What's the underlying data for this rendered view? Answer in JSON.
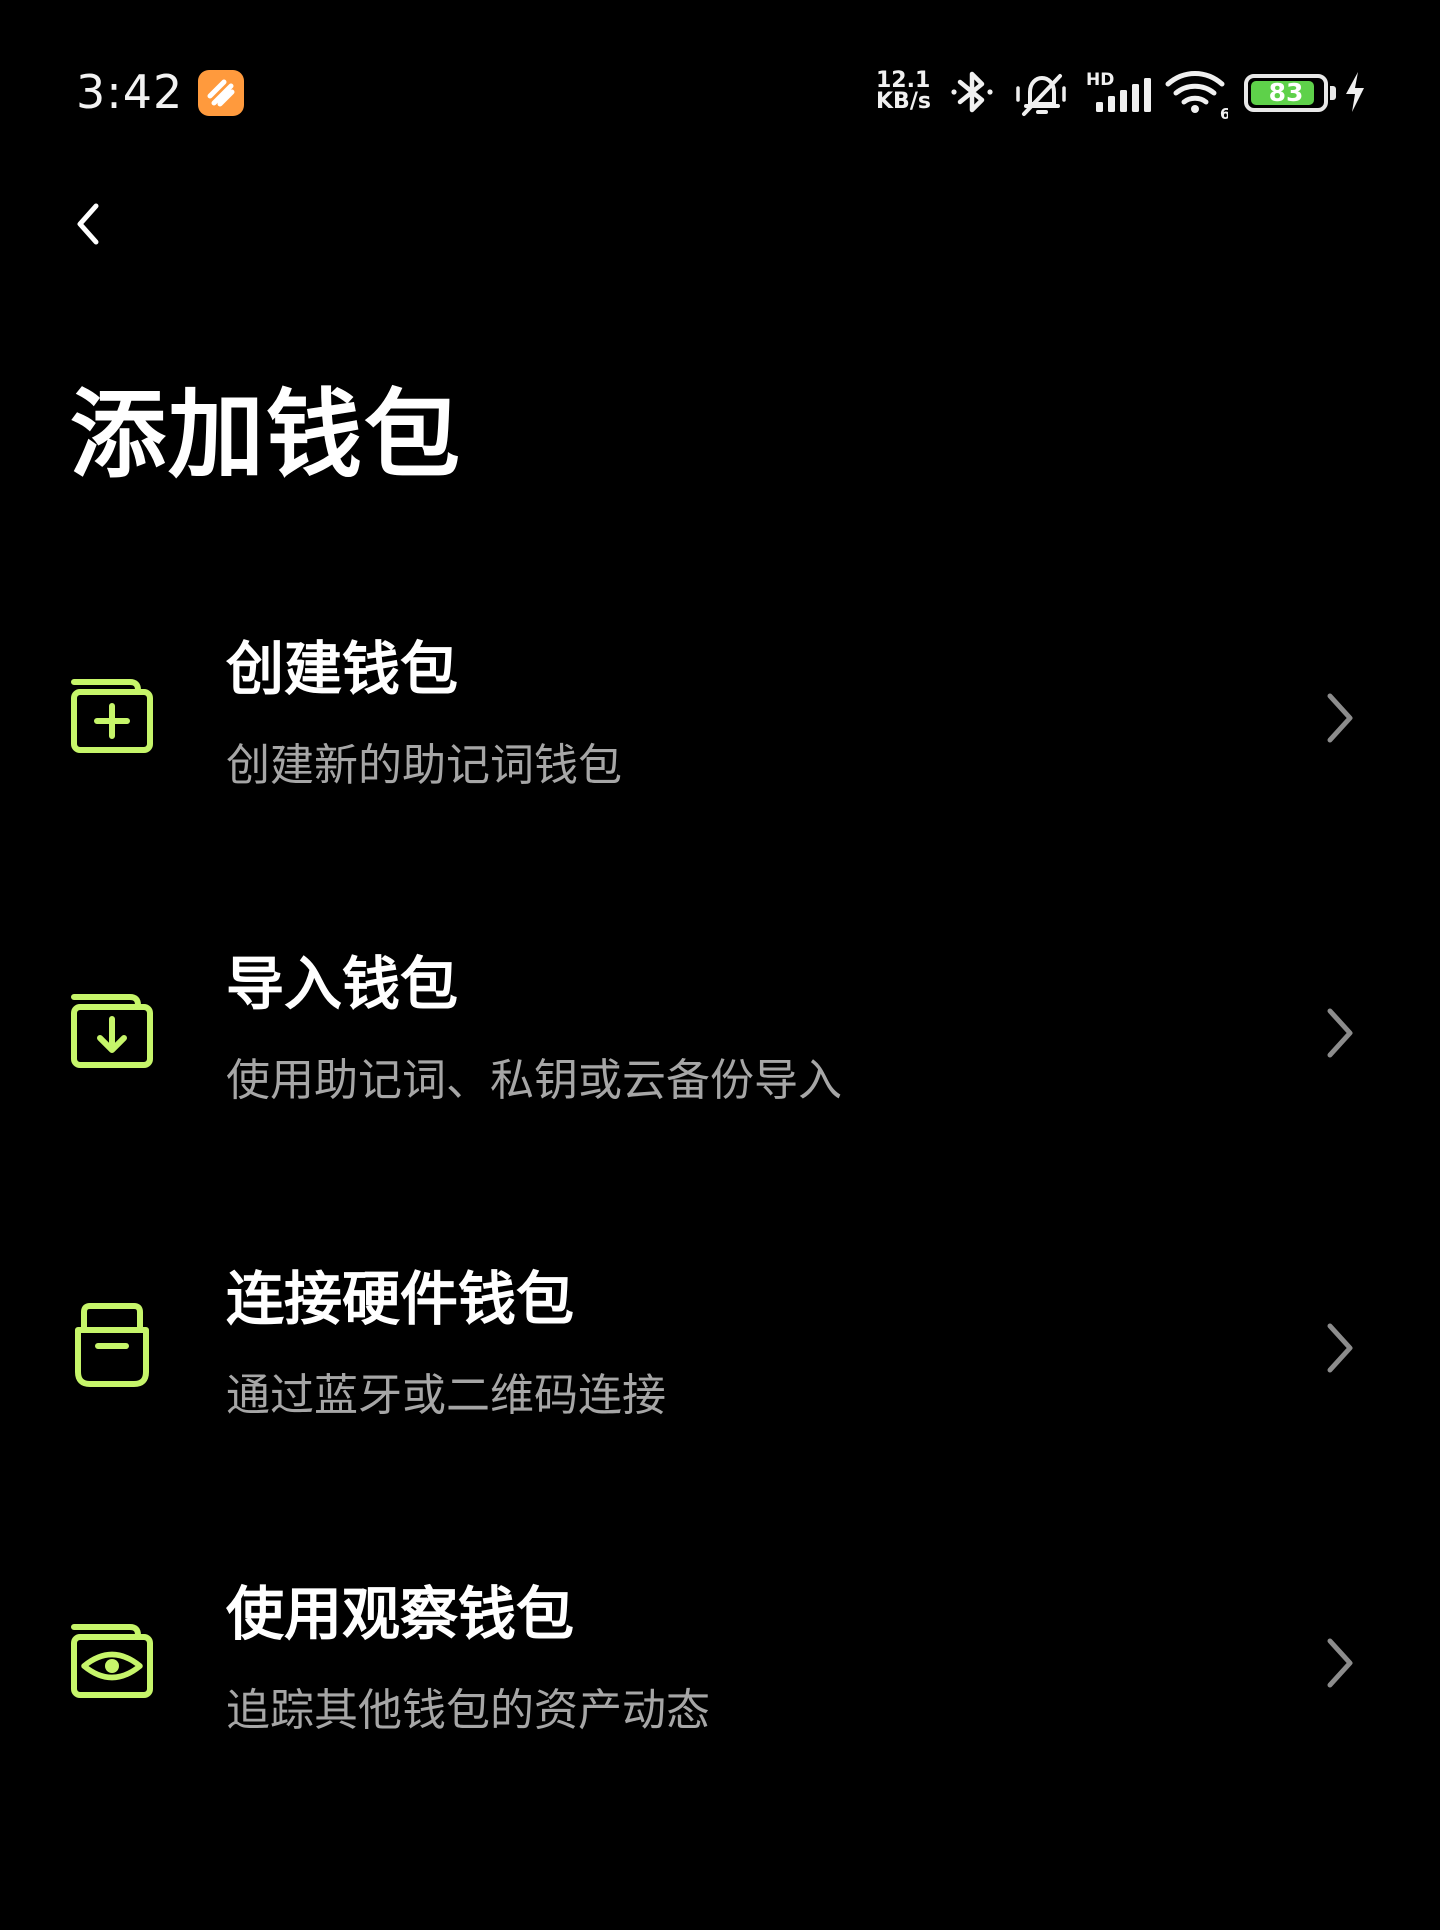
{
  "status_bar": {
    "time": "3:42",
    "net_speed_value": "12.1",
    "net_speed_unit": "KB/s",
    "network_badge": "HD",
    "wifi_badge": "6",
    "battery_level": "83",
    "battery_fraction": 0.83,
    "icons": [
      "app-notification-icon",
      "bluetooth-icon",
      "mute-icon",
      "cellular-signal-icon",
      "wifi-icon",
      "battery-icon",
      "charging-icon"
    ]
  },
  "header": {
    "back_icon": "chevron-left-icon",
    "title": "添加钱包"
  },
  "options": [
    {
      "icon": "wallet-plus-icon",
      "title": "创建钱包",
      "description": "创建新的助记词钱包"
    },
    {
      "icon": "wallet-import-icon",
      "title": "导入钱包",
      "description": "使用助记词、私钥或云备份导入"
    },
    {
      "icon": "hardware-wallet-icon",
      "title": "连接硬件钱包",
      "description": "通过蓝牙或二维码连接"
    },
    {
      "icon": "eye-icon",
      "title": "使用观察钱包",
      "description": "追踪其他钱包的资产动态"
    }
  ],
  "colors": {
    "background": "#000000",
    "accent": "#c6f56a",
    "title_text": "#ffffff",
    "description_text": "#a6a6a6",
    "chevron": "#8c8c8c",
    "battery_fill": "#5ed14a",
    "notification_app": "#ff9a3d"
  }
}
